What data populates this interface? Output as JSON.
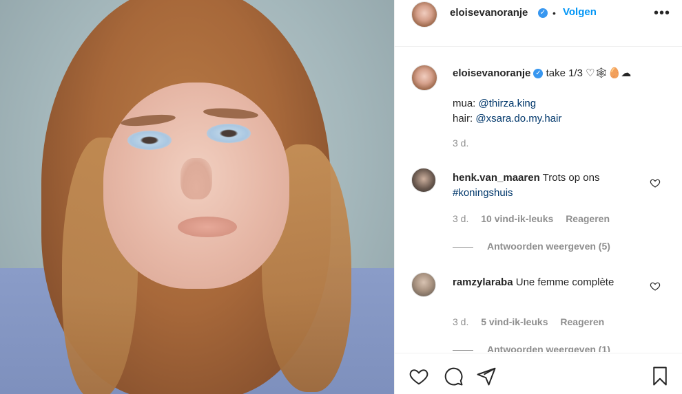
{
  "post": {
    "username": "eloisevanoranje",
    "follow_label": "Volgen",
    "more_label": "•••",
    "separator": "•"
  },
  "caption": {
    "username": "eloisevanoranje",
    "text": "take 1/3 ♡🕸🥚☁",
    "mua_label": "mua: ",
    "mua_handle": "@thirza.king",
    "hair_label": "hair: ",
    "hair_handle": "@xsara.do.my.hair",
    "time": "3 d."
  },
  "comments": [
    {
      "username": "henk.van_maaren",
      "text_before": "Trots op ons",
      "hashtag": "#koningshuis",
      "time": "3 d.",
      "likes": "10 vind-ik-leuks",
      "reply": "Reageren",
      "view_replies": "Antwoorden weergeven (5)"
    },
    {
      "username": "ramzylaraba",
      "text_before": "Une femme complète",
      "hashtag": "",
      "time": "3 d.",
      "likes": "5 vind-ik-leuks",
      "reply": "Reageren",
      "view_replies": "Antwoorden weergeven (1)"
    }
  ],
  "icons": {
    "like": "heart-icon",
    "comment": "comment-icon",
    "share": "paper-plane-icon",
    "save": "bookmark-icon",
    "verified": "verified-badge-icon"
  },
  "colors": {
    "accent": "#0095f6",
    "verified": "#3897f0",
    "mention": "#00376b",
    "muted": "#8e8e8e"
  }
}
